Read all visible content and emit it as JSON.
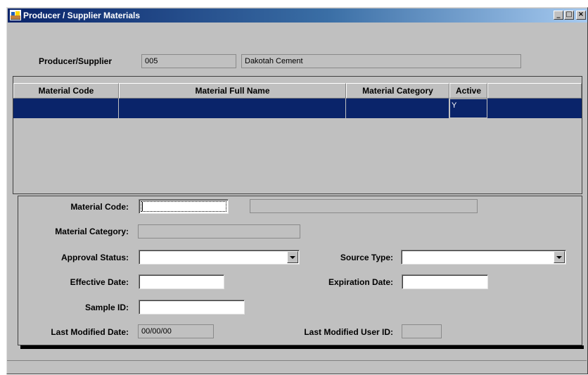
{
  "window": {
    "title": "Producer / Supplier Materials",
    "buttons": {
      "minimize": "_",
      "maximize": "□",
      "close": "×"
    }
  },
  "supplier": {
    "label": "Producer/Supplier",
    "code": "005",
    "name": "Dakotah Cement"
  },
  "grid": {
    "columns": [
      "Material Code",
      "Material Full Name",
      "Material Category",
      "Active"
    ],
    "rows": [
      {
        "material_code": "",
        "material_full_name": "",
        "material_category": "",
        "active": "Y"
      }
    ]
  },
  "form": {
    "material_code": {
      "label": "Material Code:",
      "value": "",
      "description": ""
    },
    "material_category": {
      "label": "Material Category:",
      "value": ""
    },
    "approval_status": {
      "label": "Approval Status:",
      "value": ""
    },
    "source_type": {
      "label": "Source Type:",
      "value": ""
    },
    "effective_date": {
      "label": "Effective Date:",
      "value": ""
    },
    "expiration_date": {
      "label": "Expiration Date:",
      "value": ""
    },
    "sample_id": {
      "label": "Sample ID:",
      "value": ""
    },
    "last_modified_date": {
      "label": "Last Modified Date:",
      "value": "00/00/00"
    },
    "last_modified_user": {
      "label": "Last Modified User ID:",
      "value": ""
    }
  },
  "colors": {
    "selection": "#0a246a",
    "face": "#c0c0c0",
    "title_start": "#0a246a"
  }
}
